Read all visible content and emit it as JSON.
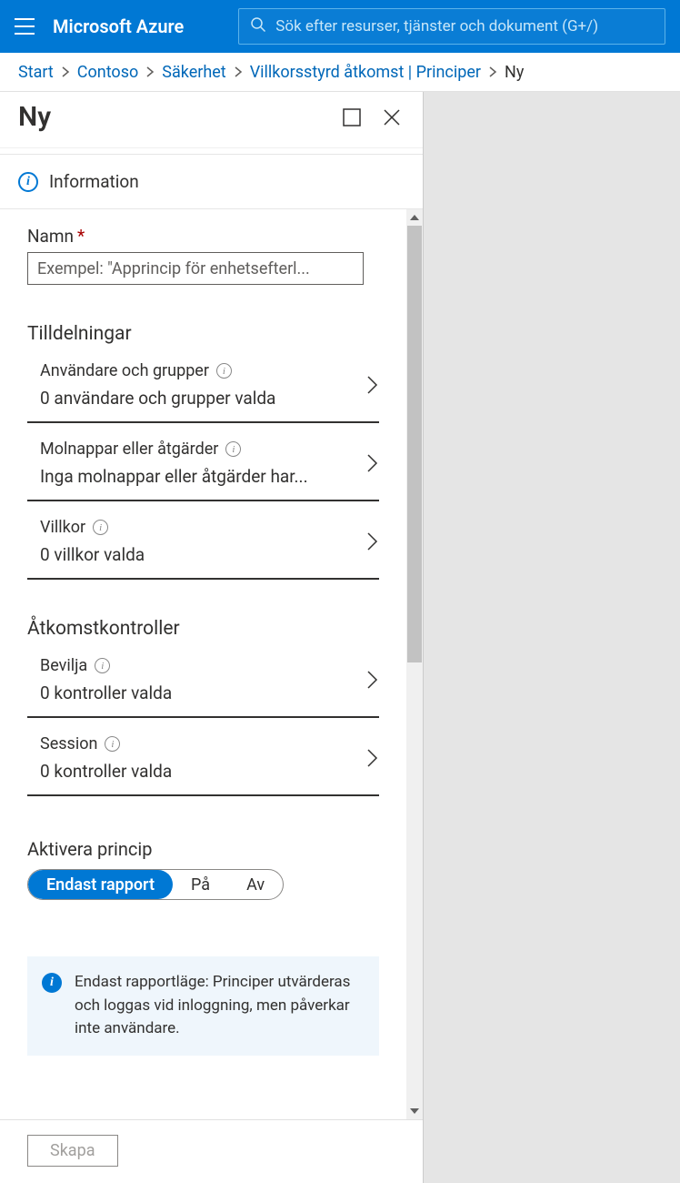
{
  "header": {
    "brand": "Microsoft Azure",
    "search_placeholder": "Sök efter resurser, tjänster och dokument (G+/)"
  },
  "breadcrumb": {
    "items": [
      "Start",
      "Contoso",
      "Säkerhet",
      "Villkorsstyrd åtkomst | Principer"
    ],
    "current": "Ny"
  },
  "blade": {
    "title": "Ny",
    "info_label": "Information",
    "name": {
      "label": "Namn",
      "placeholder": "Exempel: \"Apprincip för enhetsefterl..."
    },
    "assignments": {
      "title": "Tilldelningar",
      "items": [
        {
          "title": "Användare och grupper",
          "sub": "0 användare och grupper valda"
        },
        {
          "title": "Molnappar eller åtgärder",
          "sub": "Inga molnappar eller åtgärder har..."
        },
        {
          "title": "Villkor",
          "sub": "0 villkor valda"
        }
      ]
    },
    "access_controls": {
      "title": "Åtkomstkontroller",
      "items": [
        {
          "title": "Bevilja",
          "sub": "0 kontroller valda"
        },
        {
          "title": "Session",
          "sub": "0 kontroller valda"
        }
      ]
    },
    "enable_policy": {
      "label": "Aktivera princip",
      "options": [
        "Endast rapport",
        "På",
        "Av"
      ]
    },
    "info_banner": "Endast rapportläge: Principer utvärderas och loggas vid inloggning, men påverkar inte användare.",
    "create_button": "Skapa"
  }
}
